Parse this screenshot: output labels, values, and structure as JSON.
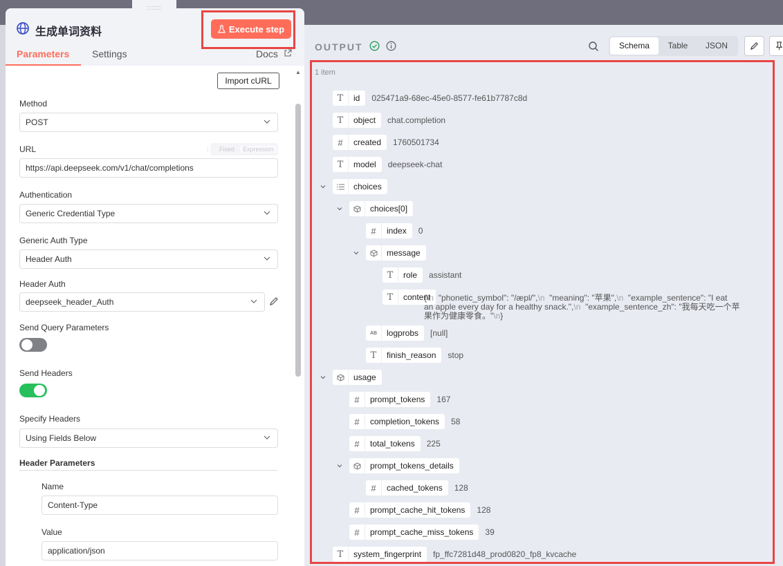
{
  "node_title": "生成单词资料",
  "execute_button": "Execute step",
  "tabs": {
    "parameters": "Parameters",
    "settings": "Settings",
    "docs": "Docs"
  },
  "import_curl": "Import cURL",
  "fields": {
    "method": {
      "label": "Method",
      "value": "POST"
    },
    "url": {
      "label": "URL",
      "value": "https://api.deepseek.com/v1/chat/completions",
      "mode_fixed": "Fixed",
      "mode_expression": "Expression"
    },
    "authentication": {
      "label": "Authentication",
      "value": "Generic Credential Type"
    },
    "generic_auth_type": {
      "label": "Generic Auth Type",
      "value": "Header Auth"
    },
    "header_auth": {
      "label": "Header Auth",
      "value": "deepseek_header_Auth"
    },
    "send_query_parameters": {
      "label": "Send Query Parameters",
      "enabled": false
    },
    "send_headers": {
      "label": "Send Headers",
      "enabled": true
    },
    "specify_headers": {
      "label": "Specify Headers",
      "value": "Using Fields Below"
    },
    "header_parameters": {
      "label": "Header Parameters"
    },
    "header_name": {
      "label": "Name",
      "value": "Content-Type"
    },
    "header_value": {
      "label": "Value",
      "value": "application/json"
    }
  },
  "output": {
    "title": "OUTPUT",
    "views": [
      "Schema",
      "Table",
      "JSON"
    ],
    "active_view": "Schema",
    "item_count": "1 item",
    "schema": {
      "id": {
        "key": "id",
        "value": "025471a9-68ec-45e0-8577-fe61b7787c8d"
      },
      "object": {
        "key": "object",
        "value": "chat.completion"
      },
      "created": {
        "key": "created",
        "value": "1760501734"
      },
      "model": {
        "key": "model",
        "value": "deepseek-chat"
      },
      "choices": {
        "key": "choices"
      },
      "choices_0": {
        "key": "choices[0]"
      },
      "index": {
        "key": "index",
        "value": "0"
      },
      "message": {
        "key": "message"
      },
      "role": {
        "key": "role",
        "value": "assistant"
      },
      "content": {
        "key": "content",
        "line1_a": "{",
        "line1_b": "\\n",
        "line1_c": "  \"phonetic_symbol\": \"/æpl/\",",
        "line1_d": "\\n",
        "line1_e": "  \"meaning\": \"苹果\",",
        "line1_f": "\\n",
        "line1_g": "  \"example_sentence\": \"I eat",
        "line2_a": "an apple every day for a healthy snack.\",",
        "line2_b": "\\n",
        "line2_c": "  \"example_sentence_zh\": \"我每天吃一个苹",
        "line3_a": "果作为健康零食。\"",
        "line3_b": "\\n",
        "line3_c": "}"
      },
      "logprobs": {
        "key": "logprobs",
        "value": "[null]"
      },
      "finish_reason": {
        "key": "finish_reason",
        "value": "stop"
      },
      "usage": {
        "key": "usage"
      },
      "prompt_tokens": {
        "key": "prompt_tokens",
        "value": "167"
      },
      "completion_tokens": {
        "key": "completion_tokens",
        "value": "58"
      },
      "total_tokens": {
        "key": "total_tokens",
        "value": "225"
      },
      "prompt_tokens_details": {
        "key": "prompt_tokens_details"
      },
      "cached_tokens": {
        "key": "cached_tokens",
        "value": "128"
      },
      "prompt_cache_hit_tokens": {
        "key": "prompt_cache_hit_tokens",
        "value": "128"
      },
      "prompt_cache_miss_tokens": {
        "key": "prompt_cache_miss_tokens",
        "value": "39"
      },
      "system_fingerprint": {
        "key": "system_fingerprint",
        "value": "fp_ffc7281d48_prod0820_fp8_kvcache"
      }
    }
  },
  "colors": {
    "accent": "#ff6d5a",
    "toggle_on": "#27c05c",
    "annotation": "#e84545"
  }
}
